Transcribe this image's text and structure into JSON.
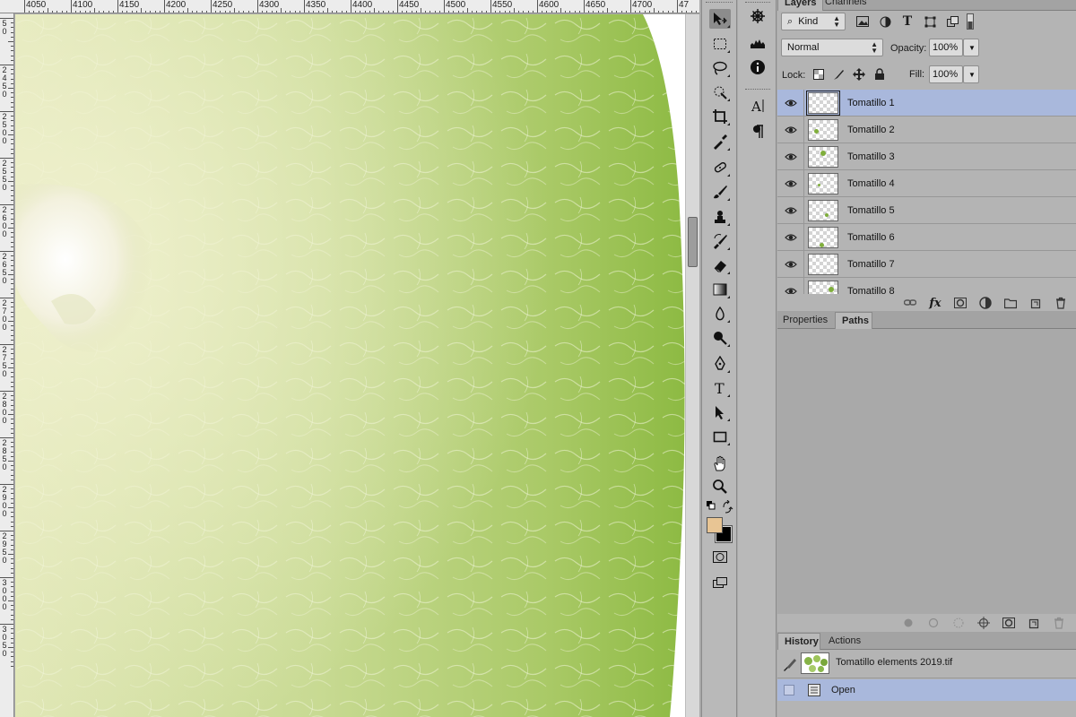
{
  "ruler": {
    "top_labels": [
      "4050",
      "4100",
      "4150",
      "4200",
      "4250",
      "4300",
      "4350",
      "4400",
      "4450",
      "4500",
      "4550",
      "4600",
      "4650",
      "4700",
      "47"
    ],
    "left_labels": [
      "5 0",
      "2 4 5 0",
      "2 5 0 0",
      "2 5 5 0",
      "2 6 0 0",
      "2 6 5 0",
      "2 7 0 0",
      "2 7 5 0",
      "2 8 0 0",
      "2 8 5 0",
      "2 9 0 0",
      "2 9 5 0",
      "3 0 0 0",
      "3 0 5 0"
    ]
  },
  "toolbar": {
    "tools": [
      "move-tool",
      "marquee-tool",
      "lasso-tool",
      "quick-selection-tool",
      "crop-tool",
      "eyedropper-tool",
      "healing-brush-tool",
      "brush-tool",
      "clone-stamp-tool",
      "history-brush-tool",
      "eraser-tool",
      "gradient-tool",
      "blur-tool",
      "dodge-tool",
      "pen-tool",
      "type-tool",
      "path-selection-tool",
      "rectangle-tool",
      "hand-tool",
      "zoom-tool"
    ],
    "foreground_color": "#e8c594",
    "background_color": "#000000"
  },
  "dock": {
    "icons": [
      "navigator-icon",
      "histogram-icon",
      "info-icon",
      "character-icon",
      "paragraph-icon"
    ]
  },
  "layers_panel": {
    "tabs": [
      "Layers",
      "Channels"
    ],
    "filter_kind": "Kind",
    "blend_mode": "Normal",
    "opacity_label": "Opacity:",
    "opacity_value": "100%",
    "lock_label": "Lock:",
    "fill_label": "Fill:",
    "fill_value": "100%",
    "layers": [
      {
        "name": "Tomatillo 1",
        "selected": true
      },
      {
        "name": "Tomatillo 2",
        "selected": false
      },
      {
        "name": "Tomatillo 3",
        "selected": false
      },
      {
        "name": "Tomatillo 4",
        "selected": false
      },
      {
        "name": "Tomatillo 5",
        "selected": false
      },
      {
        "name": "Tomatillo 6",
        "selected": false
      },
      {
        "name": "Tomatillo 7",
        "selected": false
      },
      {
        "name": "Tomatillo 8",
        "selected": false
      }
    ],
    "fx_label": "fx"
  },
  "properties_panel": {
    "tabs": [
      "Properties",
      "Paths"
    ]
  },
  "history_panel": {
    "tabs": [
      "History",
      "Actions"
    ],
    "snapshot_name": "Tomatillo elements 2019.tif",
    "steps": [
      "Open"
    ]
  },
  "colors": {
    "selection_blue": "#a9b8dc",
    "panel_gray": "#b4b4b4",
    "tomatillo_green": "#8fb84a"
  }
}
